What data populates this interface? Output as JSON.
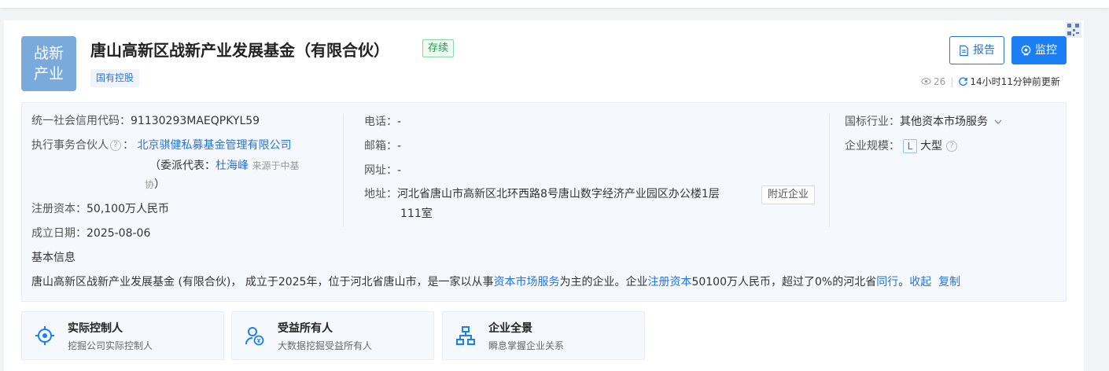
{
  "header": {
    "logo_line1": "战新",
    "logo_line2": "产业",
    "company_name": "唐山高新区战新产业发展基金（有限合伙）",
    "status": "存续",
    "tag": "国有控股",
    "report_label": "报告",
    "monitor_label": "监控",
    "view_count": "26",
    "update_text": "14小时11分钟前更新"
  },
  "info": {
    "credit_code_label": "统一社会信用代码：",
    "credit_code": "91130293MAEQPKYL59",
    "partner_label": "执行事务合伙人",
    "partner_colon": "：",
    "partner_name": "北京骐健私募基金管理有限公司",
    "delegate_prefix": "（委派代表：",
    "delegate_name": "杜海峰",
    "delegate_source_1": "来源于中基",
    "delegate_source_2": "协",
    "delegate_suffix": "）",
    "capital_label": "注册资本：",
    "capital": "50,100万人民币",
    "founded_label": "成立日期：",
    "founded": "2025-08-06",
    "phone_label": "电话：",
    "phone": "-",
    "email_label": "邮箱：",
    "email": "-",
    "website_label": "网址：",
    "website": "-",
    "address_label": "地址：",
    "address_line1": "河北省唐山市高新区北环西路8号唐山数字经济产业园区办公楼1层",
    "address_line2": "111室",
    "nearby_label": "附近企业",
    "industry_label": "国标行业：",
    "industry": "其他资本市场服务",
    "scale_label": "企业规模：",
    "scale_code": "L",
    "scale": "大型",
    "basic_info_label": "基本信息",
    "summary_part1": "唐山高新区战新产业发展基金 (有限合伙)， 成立于2025年，位于河北省唐山市，是一家以从事",
    "summary_link1": "资本市场服务",
    "summary_part2": "为主的企业。企业",
    "summary_link2": "注册资本",
    "summary_part3": "50100万人民币，超过了0%的河北省",
    "summary_link3": "同行",
    "summary_part4": "。",
    "collapse_label": "收起",
    "copy_label": "复制"
  },
  "features": [
    {
      "title": "实际控制人",
      "desc": "挖掘公司实际控制人",
      "icon": "target-icon"
    },
    {
      "title": "受益所有人",
      "desc": "大数据挖掘受益所有人",
      "icon": "beneficiary-icon"
    },
    {
      "title": "企业全景",
      "desc": "瞬息掌握企业关系",
      "icon": "org-chart-icon"
    }
  ],
  "colors": {
    "accent": "#2873d8",
    "primary_button": "#1a7ef5",
    "status_green": "#1e9e52",
    "logo_bg": "#7aaadb"
  }
}
